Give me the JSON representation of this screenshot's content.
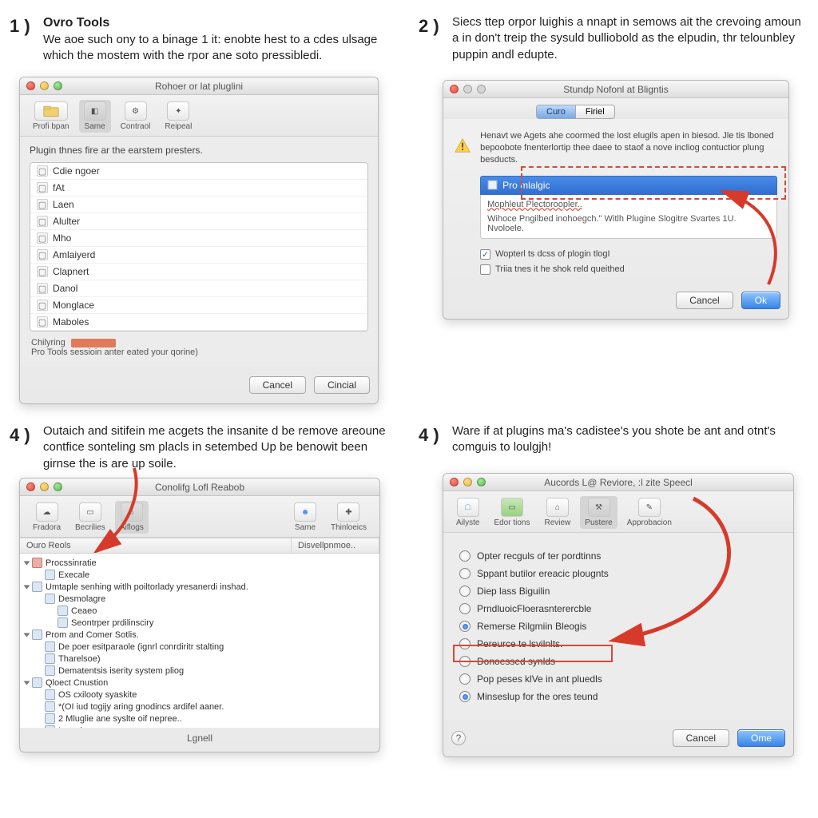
{
  "step1": {
    "num": "1 )",
    "title": "Ovro Tools",
    "desc": "We aoe such ony to a binage 1 it: enobte hest to a cdes ulsage which the mostem with the rpor ane soto pressibledi.",
    "window_title": "Rohoer or lat pluglini",
    "toolbar": {
      "profi": "Profi bpan",
      "same": "Same",
      "contract": "Contraol",
      "repeal": "Reipeal"
    },
    "list_caption": "Plugin thnes fire ar the earstem presters.",
    "items": [
      "Cdie ngoer",
      "fAt",
      "Laen",
      "Alulter",
      "Mho",
      "Amlaiyerd",
      "Clapnert",
      "Danol",
      "Monglace",
      "Maboles"
    ],
    "footer_label": "Chilyring",
    "footer_text": "Pro Tools sessioin anter eated your qorine)",
    "btn_cancel": "Cancel",
    "btn_cincial": "Cincial"
  },
  "step2": {
    "num": "2 )",
    "desc": "Siecs ttep orpor luighis a nnapt in semows ait the crevoing amoun a in don't treip the sysuld bulliobold as the elpudin, thr telounbley puppin andl edupte.",
    "window_title": "Stundp Nofonl at Bligntis",
    "tab1": "Curo",
    "tab2": "Firiel",
    "alert_text": "Henavt we Agets ahe coormed the lost elugils apen in biesod. Jle tis lboned bepoobote fnenterlortip thee daee to staof a nove incliog contuctior plung besducts.",
    "hl_title": "Pro mlalgic",
    "hl_sub": "Mophleut Plectoroopler..",
    "detail": "Wihoce Pngilbed inohoegch.\" Witlh Plugine Slogitre Svartes 1U. Nvoloele.",
    "chk1": "Wopterl ts dcss of plogin tlogI",
    "chk2": "Triia tnes it he shok reld queithed",
    "btn_cancel": "Cancel",
    "btn_ok": "Ok"
  },
  "step3": {
    "num": "4 )",
    "desc": "Outaich and sitifein me acgets the insanite d be remove areoune contfice sonteling sm placls in setembed Up be benowit been girnse the is are up soile.",
    "window_title": "Conolifg Lofl Reabob",
    "toolbar": {
      "fradora": "Fradora",
      "becrilies": "Becrilies",
      "aflogs": "Aiflogs",
      "same": "Same",
      "thinloeics": "Thinloeics"
    },
    "col1": "Ouro Reols",
    "col2": "Disvellpnmoe..",
    "tree": [
      {
        "d": 0,
        "open": true,
        "t": "Procssinratie",
        "red": true
      },
      {
        "d": 1,
        "t": "Execale"
      },
      {
        "d": 0,
        "open": true,
        "t": "Umtaple senhing witlh poiltorlady yresanerdi inshad."
      },
      {
        "d": 1,
        "t": "Desmolagre"
      },
      {
        "d": 2,
        "t": "Ceaeo"
      },
      {
        "d": 2,
        "t": "Seontrper prdilinsciry"
      },
      {
        "d": 0,
        "open": true,
        "t": "Prom and Comer Sotlis."
      },
      {
        "d": 1,
        "t": "De poer esitparaole (ignrl conrdiritr stalting"
      },
      {
        "d": 1,
        "t": "Tharelsoe)"
      },
      {
        "d": 1,
        "t": "Dematentsis iserity system pliog"
      },
      {
        "d": 0,
        "open": true,
        "t": "Qloect Cnustion"
      },
      {
        "d": 1,
        "t": "OS cxilooty syaskite"
      },
      {
        "d": 1,
        "t": "*(OI iud togijy aring gnodincs ardifel aaner."
      },
      {
        "d": 1,
        "t": "Mluglie ane syslte oif nepree..",
        "num": true
      },
      {
        "d": 1,
        "t": "Inuguino.."
      }
    ],
    "footer": "Lgnell"
  },
  "step4": {
    "num": "4 )",
    "desc": "Ware if at plugins ma's cadistee's you shote be ant and otnt's comguis to loulgjh!",
    "window_title": "Aucords L@ Reviore, :l zite Speecl",
    "toolbar": {
      "ailyste": "Ailyste",
      "editorions": "Edor tions",
      "review": "Review",
      "pustere": "Pustere",
      "approbacion": "Approbacion"
    },
    "radios": [
      {
        "t": "Opter recguls of ter pordtinns",
        "c": false
      },
      {
        "t": "Sppant butilor ereacic plougnts",
        "c": false
      },
      {
        "t": "Diep lass Biguilin",
        "c": false
      },
      {
        "t": "PrndluoicFloerasnterercble",
        "c": false
      },
      {
        "t": "Remerse Rilgmiin Bleogis",
        "c": true
      },
      {
        "t": "Pereurce te lsvilnlts.",
        "c": false,
        "boxed": true
      },
      {
        "t": "Donoessed synlds",
        "c": false
      },
      {
        "t": "Pop peses klVe in ant pluedls",
        "c": false
      },
      {
        "t": "Minseslup for the ores teund",
        "c": true
      }
    ],
    "btn_cancel": "Cancel",
    "btn_ok": "Ome"
  }
}
